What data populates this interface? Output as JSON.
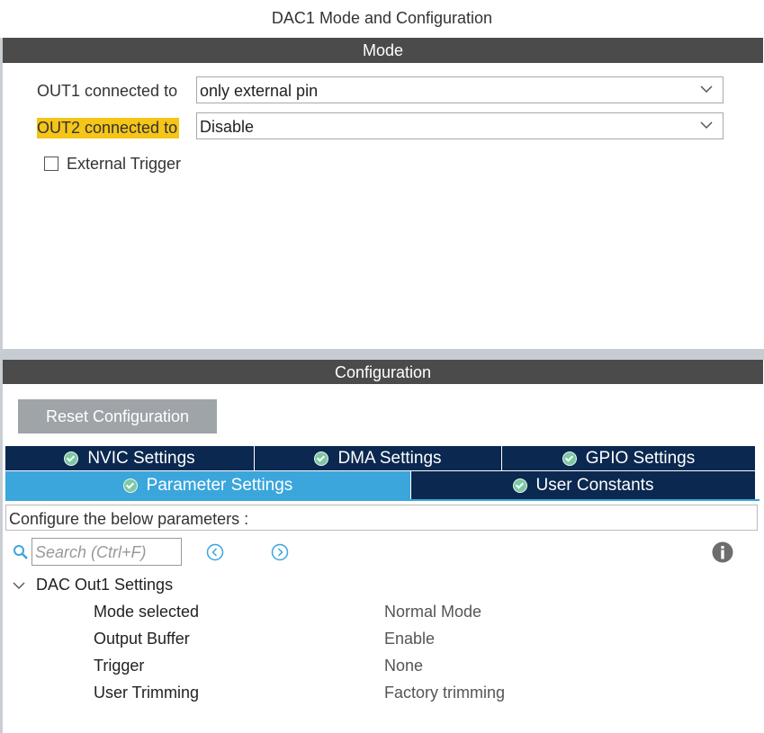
{
  "window": {
    "title": "DAC1 Mode and Configuration"
  },
  "mode": {
    "header": "Mode",
    "out1": {
      "label": "OUT1 connected to",
      "value": "only external pin"
    },
    "out2": {
      "label": "OUT2 connected to",
      "value": "Disable",
      "highlight_color": "#f5c518"
    },
    "external_trigger": {
      "label": "External Trigger",
      "checked": false
    }
  },
  "configuration": {
    "header": "Configuration",
    "reset_label": "Reset Configuration",
    "tabs": [
      {
        "label": "NVIC Settings",
        "icon": "check-circle-icon"
      },
      {
        "label": "DMA Settings",
        "icon": "check-circle-icon"
      },
      {
        "label": "GPIO Settings",
        "icon": "check-circle-icon"
      },
      {
        "label": "Parameter Settings",
        "icon": "check-circle-icon",
        "active": true
      },
      {
        "label": "User Constants",
        "icon": "check-circle-icon"
      }
    ],
    "description": "Configure the below parameters :",
    "search_placeholder": "Search (Ctrl+F)",
    "group": {
      "title": "DAC Out1 Settings",
      "params": [
        {
          "name": "Mode selected",
          "value": "Normal Mode"
        },
        {
          "name": "Output Buffer",
          "value": "Enable"
        },
        {
          "name": "Trigger",
          "value": "None"
        },
        {
          "name": "User Trimming",
          "value": "Factory trimming"
        }
      ]
    }
  },
  "colors": {
    "header_band": "#4b4b4b",
    "tab_dark": "#0a2850",
    "tab_active": "#3aa6dc",
    "status_ok": "#7dc8a5"
  }
}
